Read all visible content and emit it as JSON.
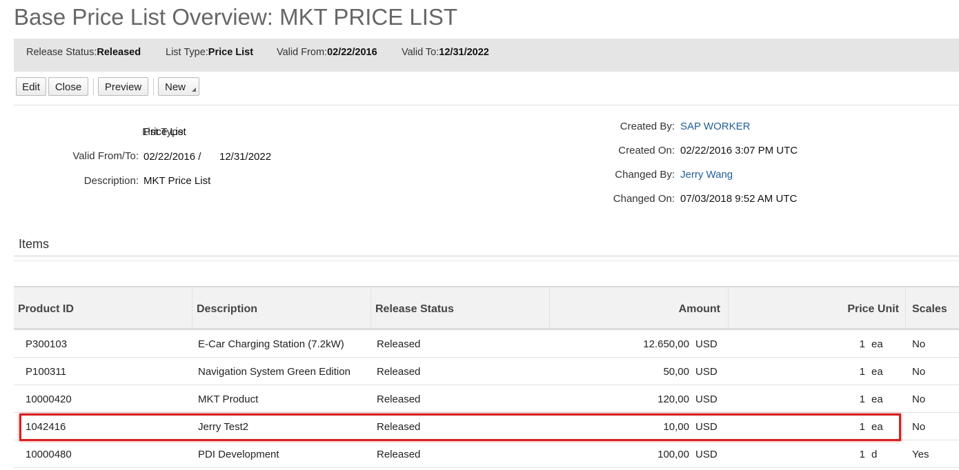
{
  "page_title": "Base Price List Overview: MKT PRICE LIST",
  "status_bar": {
    "release_status_label": "Release Status:",
    "release_status_value": "Released",
    "list_type_label": "List Type:",
    "list_type_value": "Price List",
    "valid_from_label": "Valid From:",
    "valid_from_value": "02/22/2016",
    "valid_to_label": "Valid To:",
    "valid_to_value": "12/31/2022"
  },
  "toolbar": {
    "edit_label": "Edit",
    "close_label": "Close",
    "preview_label": "Preview",
    "new_label": "New"
  },
  "details": {
    "list_type_label": "List Type:",
    "list_type_value": "Price List",
    "valid_from_to_label": "Valid From/To:",
    "valid_from_value": "02/22/2016 /",
    "valid_to_value": "12/31/2022",
    "description_label": "Description:",
    "description_value": "MKT Price List",
    "created_by_label": "Created By:",
    "created_by_value": "SAP WORKER",
    "created_on_label": "Created On:",
    "created_on_value": "02/22/2016 3:07 PM UTC",
    "changed_by_label": "Changed By:",
    "changed_by_value": "Jerry Wang",
    "changed_on_label": "Changed On:",
    "changed_on_value": "07/03/2018 9:52 AM UTC"
  },
  "items_section": {
    "title": "Items",
    "columns": {
      "product_id": "Product ID",
      "description": "Description",
      "release_status": "Release Status",
      "amount": "Amount",
      "price_unit": "Price Unit",
      "scales": "Scales"
    },
    "rows": [
      {
        "product_id": "P300103",
        "description": "E-Car Charging Station (7.2kW)",
        "release_status": "Released",
        "amount": "12.650,00",
        "currency": "USD",
        "price_unit_qty": "1",
        "price_unit_uom": "ea",
        "scales": "No"
      },
      {
        "product_id": "P100311",
        "description": "Navigation System Green Edition",
        "release_status": "Released",
        "amount": "50,00",
        "currency": "USD",
        "price_unit_qty": "1",
        "price_unit_uom": "ea",
        "scales": "No"
      },
      {
        "product_id": "10000420",
        "description": "MKT Product",
        "release_status": "Released",
        "amount": "120,00",
        "currency": "USD",
        "price_unit_qty": "1",
        "price_unit_uom": "ea",
        "scales": "No"
      },
      {
        "product_id": "1042416",
        "description": "Jerry Test2",
        "release_status": "Released",
        "amount": "10,00",
        "currency": "USD",
        "price_unit_qty": "1",
        "price_unit_uom": "ea",
        "scales": "No"
      },
      {
        "product_id": "10000480",
        "description": "PDI Development",
        "release_status": "Released",
        "amount": "100,00",
        "currency": "USD",
        "price_unit_qty": "1",
        "price_unit_uom": "d",
        "scales": "Yes"
      }
    ]
  },
  "colors": {
    "link": "#1f5f97",
    "highlight_border": "#d81e1e",
    "status_bar_bg": "#e5e5e5"
  }
}
